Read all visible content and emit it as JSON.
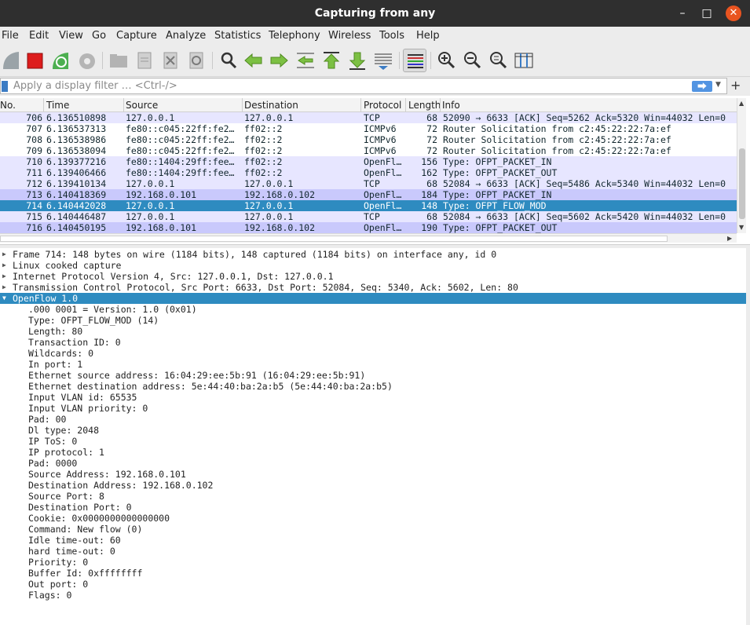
{
  "window": {
    "title": "Capturing from any"
  },
  "menu": [
    {
      "label": "File"
    },
    {
      "label": "Edit"
    },
    {
      "label": "View"
    },
    {
      "label": "Go"
    },
    {
      "label": "Capture"
    },
    {
      "label": "Analyze"
    },
    {
      "label": "Statistics"
    },
    {
      "label": "Telephony"
    },
    {
      "label": "Wireless"
    },
    {
      "label": "Tools"
    },
    {
      "label": "Help"
    }
  ],
  "toolbar": {
    "icons": [
      "start-capture-icon",
      "stop-capture-icon",
      "restart-capture-icon",
      "capture-options-icon",
      "open-file-icon",
      "save-file-icon",
      "close-file-icon",
      "reload-file-icon",
      "find-packet-icon",
      "go-back-icon",
      "go-forward-icon",
      "go-to-packet-icon",
      "first-packet-icon",
      "last-packet-icon",
      "auto-scroll-icon",
      "colorize-icon",
      "zoom-in-icon",
      "zoom-out-icon",
      "normal-size-icon",
      "resize-columns-icon"
    ]
  },
  "filter": {
    "placeholder": "Apply a display filter … <Ctrl-/>",
    "apply_label": "⮕",
    "add_label": "+"
  },
  "packet_list": {
    "columns": [
      "No.",
      "Time",
      "Source",
      "Destination",
      "Protocol",
      "Length",
      "Info"
    ],
    "rows": [
      {
        "no": "706",
        "time": "6.136510898",
        "src": "127.0.0.1",
        "dst": "127.0.0.1",
        "proto": "TCP",
        "len": "68",
        "info": "52090 → 6633 [ACK] Seq=5262 Ack=5320 Win=44032 Len=0",
        "style": "tcp"
      },
      {
        "no": "707",
        "time": "6.136537313",
        "src": "fe80::c045:22ff:fe2…",
        "dst": "ff02::2",
        "proto": "ICMPv6",
        "len": "72",
        "info": "Router Solicitation from c2:45:22:22:7a:ef",
        "style": "icmp"
      },
      {
        "no": "708",
        "time": "6.136538986",
        "src": "fe80::c045:22ff:fe2…",
        "dst": "ff02::2",
        "proto": "ICMPv6",
        "len": "72",
        "info": "Router Solicitation from c2:45:22:22:7a:ef",
        "style": "icmp"
      },
      {
        "no": "709",
        "time": "6.136538094",
        "src": "fe80::c045:22ff:fe2…",
        "dst": "ff02::2",
        "proto": "ICMPv6",
        "len": "72",
        "info": "Router Solicitation from c2:45:22:22:7a:ef",
        "style": "icmp"
      },
      {
        "no": "710",
        "time": "6.139377216",
        "src": "fe80::1404:29ff:fee…",
        "dst": "ff02::2",
        "proto": "OpenFl…",
        "len": "156",
        "info": "Type: OFPT_PACKET_IN",
        "style": "of2"
      },
      {
        "no": "711",
        "time": "6.139406466",
        "src": "fe80::1404:29ff:fee…",
        "dst": "ff02::2",
        "proto": "OpenFl…",
        "len": "162",
        "info": "Type: OFPT_PACKET_OUT",
        "style": "of2"
      },
      {
        "no": "712",
        "time": "6.139410134",
        "src": "127.0.0.1",
        "dst": "127.0.0.1",
        "proto": "TCP",
        "len": "68",
        "info": "52084 → 6633 [ACK] Seq=5486 Ack=5340 Win=44032 Len=0",
        "style": "tcp"
      },
      {
        "no": "713",
        "time": "6.140418369",
        "src": "192.168.0.101",
        "dst": "192.168.0.102",
        "proto": "OpenFl…",
        "len": "184",
        "info": "Type: OFPT_PACKET_IN",
        "style": "of"
      },
      {
        "no": "714",
        "time": "6.140442028",
        "src": "127.0.0.1",
        "dst": "127.0.0.1",
        "proto": "OpenFl…",
        "len": "148",
        "info": "Type: OFPT_FLOW_MOD",
        "style": "sel"
      },
      {
        "no": "715",
        "time": "6.140446487",
        "src": "127.0.0.1",
        "dst": "127.0.0.1",
        "proto": "TCP",
        "len": "68",
        "info": "52084 → 6633 [ACK] Seq=5602 Ack=5420 Win=44032 Len=0",
        "style": "tcp"
      },
      {
        "no": "716",
        "time": "6.140450195",
        "src": "192.168.0.101",
        "dst": "192.168.0.102",
        "proto": "OpenFl…",
        "len": "190",
        "info": "Type: OFPT_PACKET_OUT",
        "style": "of"
      }
    ]
  },
  "details": {
    "tree": [
      {
        "text": "Frame 714: 148 bytes on wire (1184 bits), 148 captured (1184 bits) on interface any, id 0",
        "level": 0,
        "state": "collapsed"
      },
      {
        "text": "Linux cooked capture",
        "level": 0,
        "state": "collapsed"
      },
      {
        "text": "Internet Protocol Version 4, Src: 127.0.0.1, Dst: 127.0.0.1",
        "level": 0,
        "state": "collapsed"
      },
      {
        "text": "Transmission Control Protocol, Src Port: 6633, Dst Port: 52084, Seq: 5340, Ack: 5602, Len: 80",
        "level": 0,
        "state": "collapsed"
      },
      {
        "text": "OpenFlow 1.0",
        "level": 0,
        "state": "expanded",
        "selected": true
      },
      {
        "text": ".000 0001 = Version: 1.0 (0x01)",
        "level": 1
      },
      {
        "text": "Type: OFPT_FLOW_MOD (14)",
        "level": 1
      },
      {
        "text": "Length: 80",
        "level": 1
      },
      {
        "text": "Transaction ID: 0",
        "level": 1
      },
      {
        "text": "Wildcards: 0",
        "level": 1
      },
      {
        "text": "In port: 1",
        "level": 1
      },
      {
        "text": "Ethernet source address: 16:04:29:ee:5b:91 (16:04:29:ee:5b:91)",
        "level": 1
      },
      {
        "text": "Ethernet destination address: 5e:44:40:ba:2a:b5 (5e:44:40:ba:2a:b5)",
        "level": 1
      },
      {
        "text": "Input VLAN id: 65535",
        "level": 1
      },
      {
        "text": "Input VLAN priority: 0",
        "level": 1
      },
      {
        "text": "Pad: 00",
        "level": 1
      },
      {
        "text": "Dl type: 2048",
        "level": 1
      },
      {
        "text": "IP ToS: 0",
        "level": 1
      },
      {
        "text": "IP protocol: 1",
        "level": 1
      },
      {
        "text": "Pad: 0000",
        "level": 1
      },
      {
        "text": "Source Address: 192.168.0.101",
        "level": 1
      },
      {
        "text": "Destination Address: 192.168.0.102",
        "level": 1
      },
      {
        "text": "Source Port: 8",
        "level": 1
      },
      {
        "text": "Destination Port: 0",
        "level": 1
      },
      {
        "text": "Cookie: 0x0000000000000000",
        "level": 1
      },
      {
        "text": "Command: New flow (0)",
        "level": 1
      },
      {
        "text": "Idle time-out: 60",
        "level": 1
      },
      {
        "text": "hard time-out: 0",
        "level": 1
      },
      {
        "text": "Priority: 0",
        "level": 1
      },
      {
        "text": "Buffer Id: 0xffffffff",
        "level": 1
      },
      {
        "text": "Out port: 0",
        "level": 1
      },
      {
        "text": "Flags: 0",
        "level": 1
      }
    ]
  },
  "colors": {
    "titlebar": "#2f2f2f",
    "close_button": "#e95420",
    "selection": "#2e8bc0",
    "tcp_row": "#e7e6ff",
    "openflow_row": "#c9c9fc"
  }
}
